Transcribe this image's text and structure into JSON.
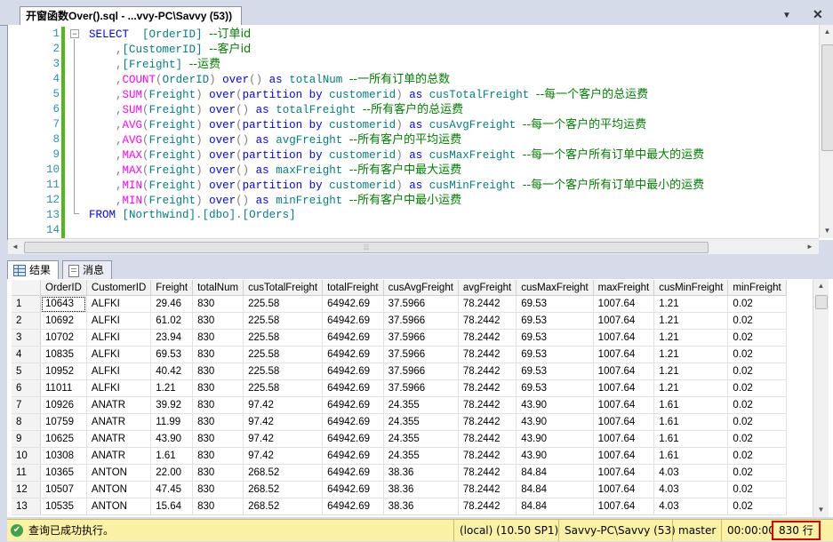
{
  "document_tab": {
    "title": "开窗函数Over().sql - ...vvy-PC\\Savvy (53))",
    "dropdown_glyph": "▼",
    "close_glyph": "✕"
  },
  "editor": {
    "line_numbers": [
      "1",
      "2",
      "3",
      "4",
      "5",
      "6",
      "7",
      "8",
      "9",
      "10",
      "11",
      "12",
      "13",
      "14"
    ],
    "lines": [
      [
        {
          "t": "SELECT",
          "c": "kw"
        },
        {
          "t": "  "
        },
        {
          "t": "[OrderID]",
          "c": "id"
        },
        {
          "t": " "
        },
        {
          "t": "--订单id",
          "c": "cm"
        }
      ],
      [
        {
          "t": "    "
        },
        {
          "t": ",",
          "c": "gr"
        },
        {
          "t": "[CustomerID]",
          "c": "id"
        },
        {
          "t": " "
        },
        {
          "t": "--客户id",
          "c": "cm"
        }
      ],
      [
        {
          "t": "    "
        },
        {
          "t": ",",
          "c": "gr"
        },
        {
          "t": "[Freight]",
          "c": "id"
        },
        {
          "t": " "
        },
        {
          "t": "--运费",
          "c": "cm"
        }
      ],
      [
        {
          "t": "    "
        },
        {
          "t": ",",
          "c": "gr"
        },
        {
          "t": "COUNT",
          "c": "fn"
        },
        {
          "t": "(",
          "c": "gr"
        },
        {
          "t": "OrderID",
          "c": "id"
        },
        {
          "t": ")",
          "c": "gr"
        },
        {
          "t": " "
        },
        {
          "t": "over",
          "c": "kw"
        },
        {
          "t": "()",
          "c": "gr"
        },
        {
          "t": " "
        },
        {
          "t": "as",
          "c": "kw"
        },
        {
          "t": " "
        },
        {
          "t": "totalNum",
          "c": "id"
        },
        {
          "t": " "
        },
        {
          "t": "--一所有订单的总数",
          "c": "cm"
        }
      ],
      [
        {
          "t": "    "
        },
        {
          "t": ",",
          "c": "gr"
        },
        {
          "t": "SUM",
          "c": "fn"
        },
        {
          "t": "(",
          "c": "gr"
        },
        {
          "t": "Freight",
          "c": "id"
        },
        {
          "t": ")",
          "c": "gr"
        },
        {
          "t": " "
        },
        {
          "t": "over",
          "c": "kw"
        },
        {
          "t": "(",
          "c": "gr"
        },
        {
          "t": "partition by",
          "c": "kw"
        },
        {
          "t": " "
        },
        {
          "t": "customerid",
          "c": "id"
        },
        {
          "t": ")",
          "c": "gr"
        },
        {
          "t": " "
        },
        {
          "t": "as",
          "c": "kw"
        },
        {
          "t": " "
        },
        {
          "t": "cusTotalFreight",
          "c": "id"
        },
        {
          "t": " "
        },
        {
          "t": "--每一个客户的总运费",
          "c": "cm"
        }
      ],
      [
        {
          "t": "    "
        },
        {
          "t": ",",
          "c": "gr"
        },
        {
          "t": "SUM",
          "c": "fn"
        },
        {
          "t": "(",
          "c": "gr"
        },
        {
          "t": "Freight",
          "c": "id"
        },
        {
          "t": ")",
          "c": "gr"
        },
        {
          "t": " "
        },
        {
          "t": "over",
          "c": "kw"
        },
        {
          "t": "()",
          "c": "gr"
        },
        {
          "t": " "
        },
        {
          "t": "as",
          "c": "kw"
        },
        {
          "t": " "
        },
        {
          "t": "totalFreight",
          "c": "id"
        },
        {
          "t": " "
        },
        {
          "t": "--所有客户的总运费",
          "c": "cm"
        }
      ],
      [
        {
          "t": "    "
        },
        {
          "t": ",",
          "c": "gr"
        },
        {
          "t": "AVG",
          "c": "fn"
        },
        {
          "t": "(",
          "c": "gr"
        },
        {
          "t": "Freight",
          "c": "id"
        },
        {
          "t": ")",
          "c": "gr"
        },
        {
          "t": " "
        },
        {
          "t": "over",
          "c": "kw"
        },
        {
          "t": "(",
          "c": "gr"
        },
        {
          "t": "partition by",
          "c": "kw"
        },
        {
          "t": " "
        },
        {
          "t": "customerid",
          "c": "id"
        },
        {
          "t": ")",
          "c": "gr"
        },
        {
          "t": " "
        },
        {
          "t": "as",
          "c": "kw"
        },
        {
          "t": " "
        },
        {
          "t": "cusAvgFreight",
          "c": "id"
        },
        {
          "t": " "
        },
        {
          "t": "--每一个客户的平均运费",
          "c": "cm"
        }
      ],
      [
        {
          "t": "    "
        },
        {
          "t": ",",
          "c": "gr"
        },
        {
          "t": "AVG",
          "c": "fn"
        },
        {
          "t": "(",
          "c": "gr"
        },
        {
          "t": "Freight",
          "c": "id"
        },
        {
          "t": ")",
          "c": "gr"
        },
        {
          "t": " "
        },
        {
          "t": "over",
          "c": "kw"
        },
        {
          "t": "()",
          "c": "gr"
        },
        {
          "t": " "
        },
        {
          "t": "as",
          "c": "kw"
        },
        {
          "t": " "
        },
        {
          "t": "avgFreight",
          "c": "id"
        },
        {
          "t": " "
        },
        {
          "t": "--所有客户的平均运费",
          "c": "cm"
        }
      ],
      [
        {
          "t": "    "
        },
        {
          "t": ",",
          "c": "gr"
        },
        {
          "t": "MAX",
          "c": "fn"
        },
        {
          "t": "(",
          "c": "gr"
        },
        {
          "t": "Freight",
          "c": "id"
        },
        {
          "t": ")",
          "c": "gr"
        },
        {
          "t": " "
        },
        {
          "t": "over",
          "c": "kw"
        },
        {
          "t": "(",
          "c": "gr"
        },
        {
          "t": "partition by",
          "c": "kw"
        },
        {
          "t": " "
        },
        {
          "t": "customerid",
          "c": "id"
        },
        {
          "t": ")",
          "c": "gr"
        },
        {
          "t": " "
        },
        {
          "t": "as",
          "c": "kw"
        },
        {
          "t": " "
        },
        {
          "t": "cusMaxFreight",
          "c": "id"
        },
        {
          "t": " "
        },
        {
          "t": "--每一个客户所有订单中最大的运费",
          "c": "cm"
        }
      ],
      [
        {
          "t": "    "
        },
        {
          "t": ",",
          "c": "gr"
        },
        {
          "t": "MAX",
          "c": "fn"
        },
        {
          "t": "(",
          "c": "gr"
        },
        {
          "t": "Freight",
          "c": "id"
        },
        {
          "t": ")",
          "c": "gr"
        },
        {
          "t": " "
        },
        {
          "t": "over",
          "c": "kw"
        },
        {
          "t": "()",
          "c": "gr"
        },
        {
          "t": " "
        },
        {
          "t": "as",
          "c": "kw"
        },
        {
          "t": " "
        },
        {
          "t": "maxFreight",
          "c": "id"
        },
        {
          "t": " "
        },
        {
          "t": "--所有客户中最大运费",
          "c": "cm"
        }
      ],
      [
        {
          "t": "    "
        },
        {
          "t": ",",
          "c": "gr"
        },
        {
          "t": "MIN",
          "c": "fn"
        },
        {
          "t": "(",
          "c": "gr"
        },
        {
          "t": "Freight",
          "c": "id"
        },
        {
          "t": ")",
          "c": "gr"
        },
        {
          "t": " "
        },
        {
          "t": "over",
          "c": "kw"
        },
        {
          "t": "(",
          "c": "gr"
        },
        {
          "t": "partition by",
          "c": "kw"
        },
        {
          "t": " "
        },
        {
          "t": "customerid",
          "c": "id"
        },
        {
          "t": ")",
          "c": "gr"
        },
        {
          "t": " "
        },
        {
          "t": "as",
          "c": "kw"
        },
        {
          "t": " "
        },
        {
          "t": "cusMinFreight",
          "c": "id"
        },
        {
          "t": " "
        },
        {
          "t": "--每一个客户所有订单中最小的运费",
          "c": "cm"
        }
      ],
      [
        {
          "t": "    "
        },
        {
          "t": ",",
          "c": "gr"
        },
        {
          "t": "MIN",
          "c": "fn"
        },
        {
          "t": "(",
          "c": "gr"
        },
        {
          "t": "Freight",
          "c": "id"
        },
        {
          "t": ")",
          "c": "gr"
        },
        {
          "t": " "
        },
        {
          "t": "over",
          "c": "kw"
        },
        {
          "t": "()",
          "c": "gr"
        },
        {
          "t": " "
        },
        {
          "t": "as",
          "c": "kw"
        },
        {
          "t": " "
        },
        {
          "t": "minFreight",
          "c": "id"
        },
        {
          "t": " "
        },
        {
          "t": "--所有客户中最小运费",
          "c": "cm"
        }
      ],
      [
        {
          "t": "FROM",
          "c": "kw"
        },
        {
          "t": " "
        },
        {
          "t": "[Northwind]",
          "c": "id"
        },
        {
          "t": ".",
          "c": "gr"
        },
        {
          "t": "[dbo]",
          "c": "id"
        },
        {
          "t": ".",
          "c": "gr"
        },
        {
          "t": "[Orders]",
          "c": "id"
        }
      ],
      []
    ],
    "colors": {
      "keyword": "#0000ff",
      "function": "#ff00ff",
      "operator": "#808080",
      "identifier": "#008080",
      "comment": "#008000",
      "line_number": "#2b91af",
      "changed_bar": "#4cbb17"
    }
  },
  "result_tabs": {
    "results_label": "结果",
    "messages_label": "消息"
  },
  "grid": {
    "columns": [
      "OrderID",
      "CustomerID",
      "Freight",
      "totalNum",
      "cusTotalFreight",
      "totalFreight",
      "cusAvgFreight",
      "avgFreight",
      "cusMaxFreight",
      "maxFreight",
      "cusMinFreight",
      "minFreight"
    ],
    "rows": [
      [
        "1",
        "10643",
        "ALFKI",
        "29.46",
        "830",
        "225.58",
        "64942.69",
        "37.5966",
        "78.2442",
        "69.53",
        "1007.64",
        "1.21",
        "0.02"
      ],
      [
        "2",
        "10692",
        "ALFKI",
        "61.02",
        "830",
        "225.58",
        "64942.69",
        "37.5966",
        "78.2442",
        "69.53",
        "1007.64",
        "1.21",
        "0.02"
      ],
      [
        "3",
        "10702",
        "ALFKI",
        "23.94",
        "830",
        "225.58",
        "64942.69",
        "37.5966",
        "78.2442",
        "69.53",
        "1007.64",
        "1.21",
        "0.02"
      ],
      [
        "4",
        "10835",
        "ALFKI",
        "69.53",
        "830",
        "225.58",
        "64942.69",
        "37.5966",
        "78.2442",
        "69.53",
        "1007.64",
        "1.21",
        "0.02"
      ],
      [
        "5",
        "10952",
        "ALFKI",
        "40.42",
        "830",
        "225.58",
        "64942.69",
        "37.5966",
        "78.2442",
        "69.53",
        "1007.64",
        "1.21",
        "0.02"
      ],
      [
        "6",
        "11011",
        "ALFKI",
        "1.21",
        "830",
        "225.58",
        "64942.69",
        "37.5966",
        "78.2442",
        "69.53",
        "1007.64",
        "1.21",
        "0.02"
      ],
      [
        "7",
        "10926",
        "ANATR",
        "39.92",
        "830",
        "97.42",
        "64942.69",
        "24.355",
        "78.2442",
        "43.90",
        "1007.64",
        "1.61",
        "0.02"
      ],
      [
        "8",
        "10759",
        "ANATR",
        "11.99",
        "830",
        "97.42",
        "64942.69",
        "24.355",
        "78.2442",
        "43.90",
        "1007.64",
        "1.61",
        "0.02"
      ],
      [
        "9",
        "10625",
        "ANATR",
        "43.90",
        "830",
        "97.42",
        "64942.69",
        "24.355",
        "78.2442",
        "43.90",
        "1007.64",
        "1.61",
        "0.02"
      ],
      [
        "10",
        "10308",
        "ANATR",
        "1.61",
        "830",
        "97.42",
        "64942.69",
        "24.355",
        "78.2442",
        "43.90",
        "1007.64",
        "1.61",
        "0.02"
      ],
      [
        "11",
        "10365",
        "ANTON",
        "22.00",
        "830",
        "268.52",
        "64942.69",
        "38.36",
        "78.2442",
        "84.84",
        "1007.64",
        "4.03",
        "0.02"
      ],
      [
        "12",
        "10507",
        "ANTON",
        "47.45",
        "830",
        "268.52",
        "64942.69",
        "38.36",
        "78.2442",
        "84.84",
        "1007.64",
        "4.03",
        "0.02"
      ],
      [
        "13",
        "10535",
        "ANTON",
        "15.64",
        "830",
        "268.52",
        "64942.69",
        "38.36",
        "78.2442",
        "84.84",
        "1007.64",
        "4.03",
        "0.02"
      ]
    ]
  },
  "statusbar": {
    "message": "查询已成功执行。",
    "server": "(local) (10.50 SP1)",
    "login": "Savvy-PC\\Savvy (53)",
    "database": "master",
    "elapsed": "00:00:00",
    "row_count": "830 行",
    "ok_icon": "✔",
    "highlight_color": "#e00000",
    "background_color": "#fbf1a4"
  },
  "scroll_glyphs": {
    "up": "▲",
    "down": "▼",
    "left": "◄",
    "right": "►",
    "grip": "⦙⦙⦙"
  }
}
